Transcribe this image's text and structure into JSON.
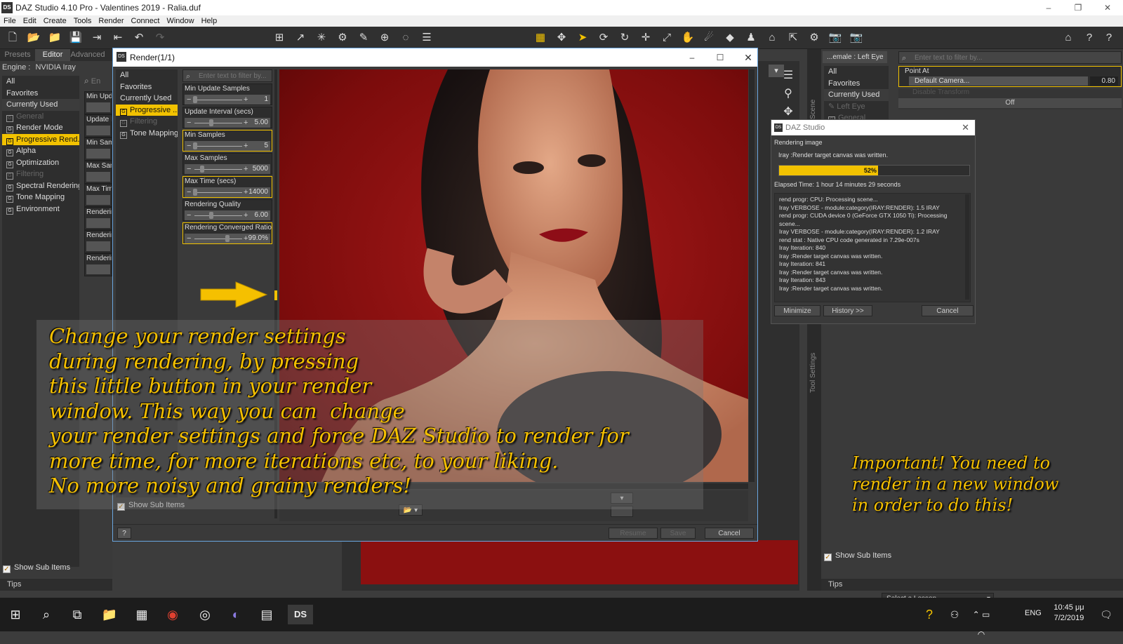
{
  "app": {
    "title": "DAZ Studio 4.10 Pro - Valentines 2019 - Ralia.duf",
    "window_controls": [
      "–",
      "❐",
      "✕"
    ]
  },
  "menu": [
    "File",
    "Edit",
    "Create",
    "Tools",
    "Render",
    "Connect",
    "Window",
    "Help"
  ],
  "left_panel": {
    "tabs": [
      "Presets",
      "Editor",
      "Advanced"
    ],
    "active_tab": "Editor",
    "engine_label": "Engine :",
    "engine_value": "NVIDIA Iray",
    "search_placeholder": "En",
    "groups": [
      "All",
      "Favorites",
      "Currently Used",
      "General",
      "Render Mode",
      "Progressive Rend...",
      "Alpha",
      "Optimization",
      "Filtering",
      "Spectral Rendering",
      "Tone Mapping",
      "Environment"
    ],
    "props_partial": [
      "Min Upda",
      "Update I",
      "Min Samp",
      "Max Sam",
      "Max Time",
      "Renderin",
      "Renderin",
      "Renderin"
    ],
    "show_sub_items": "Show Sub Items",
    "tips": "Tips"
  },
  "render_dialog": {
    "title": "Render(1/1)",
    "groups": [
      "All",
      "Favorites",
      "Currently Used",
      "Progressive ...",
      "Filtering",
      "Tone Mapping"
    ],
    "search_placeholder": "Enter text to filter by...",
    "props": [
      {
        "label": "Min Update Samples",
        "value": "1",
        "fraction": 0.0
      },
      {
        "label": "Update Interval (secs)",
        "value": "5.00",
        "fraction": 0.35
      },
      {
        "label": "Min Samples",
        "value": "5",
        "fraction": 0.0
      },
      {
        "label": "Max Samples",
        "value": "5000",
        "fraction": 0.15
      },
      {
        "label": "Max Time (secs)",
        "value": "14000",
        "fraction": 0.0
      },
      {
        "label": "Rendering Quality",
        "value": "6.00",
        "fraction": 0.35
      },
      {
        "label": "Rendering Converged Ratio",
        "value": "99.0%",
        "fraction": 0.7
      }
    ],
    "show_sub_items": "Show Sub Items",
    "help_icon": "?",
    "buttons": {
      "resume": "Resume",
      "save": "Save",
      "cancel": "Cancel"
    }
  },
  "progress_dialog": {
    "title": "DAZ Studio",
    "status": "Rendering image",
    "message": "Iray :Render target canvas was written.",
    "progress_percent": 52,
    "progress_label": "52%",
    "elapsed": "Elapsed Time:  1 hour 14 minutes 29 seconds",
    "log": [
      "rend progr: CPU: Processing scene...",
      "Iray VERBOSE - module:category(IRAY:RENDER):   1.5   IRAY",
      "rend progr: CUDA device 0 (GeForce GTX 1050 Ti): Processing",
      "scene...",
      "Iray VERBOSE - module:category(IRAY:RENDER):   1.2   IRAY",
      "rend stat : Native CPU code generated in 7.29e-007s",
      "Iray Iteration: 840",
      "Iray :Render target canvas was written.",
      "Iray Iteration: 841",
      "Iray :Render target canvas was written.",
      "Iray Iteration: 843",
      "Iray :Render target canvas was written."
    ],
    "buttons": {
      "minimize": "Minimize",
      "history": "History >>",
      "cancel": "Cancel"
    }
  },
  "right_panel": {
    "node_select": "...emale : Left Eye",
    "search_placeholder": "Enter text to filter by...",
    "groups": [
      "All",
      "Favorites",
      "Currently Used",
      "Left Eye",
      "General"
    ],
    "point_at_label": "Point At",
    "point_at_value": "Default Camera...",
    "point_at_num": "0.80",
    "disable_transform": "Disable Transform",
    "off_value": "Off",
    "side_tabs": [
      "Scene",
      "Tool Settings"
    ],
    "show_sub_items": "Show Sub Items",
    "tips": "Tips",
    "lesson_select": "Select a Lesson..."
  },
  "captions": {
    "main": "Change your render settings\nduring rendering, by pressing\nthis little button in your render\nwindow. This way you can  change\nyour render settings and force DAZ Studio to render for\nmore time, for more iterations etc, to your liking.\nNo more noisy and grainy renders!",
    "side": "Important! You need to\nrender in a new window\nin order to do this!"
  },
  "taskbar": {
    "lang": "ENG",
    "time": "10:45 μμ",
    "date": "7/2/2019"
  },
  "colors": {
    "accent": "#f2c200",
    "panel": "#3a3a3a",
    "render_bg": "#9e1414"
  }
}
